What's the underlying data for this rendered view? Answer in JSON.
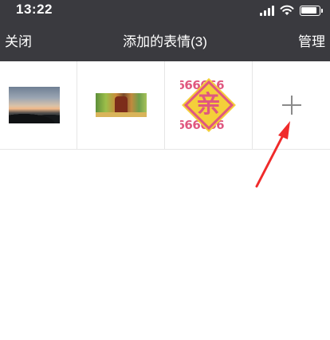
{
  "status_bar": {
    "time": "13:22",
    "icons": [
      "signal-icon",
      "wifi-icon",
      "battery-icon"
    ]
  },
  "nav": {
    "close_label": "关闭",
    "title": "添加的表情(3)",
    "manage_label": "管理"
  },
  "stickers": [
    {
      "icon": "sunset-photo"
    },
    {
      "icon": "temple-photo"
    },
    {
      "icon": "qin-sticker",
      "char": "亲",
      "digits": "666666"
    }
  ],
  "add_button": {
    "icon": "plus-icon"
  },
  "annotation": {
    "icon": "red-arrow-icon",
    "color": "#f02a2a"
  },
  "colors": {
    "header_bg": "#3a3a3f",
    "header_text": "#ffffff",
    "divider": "#e6e6e6",
    "plus": "#8a8a8a"
  }
}
